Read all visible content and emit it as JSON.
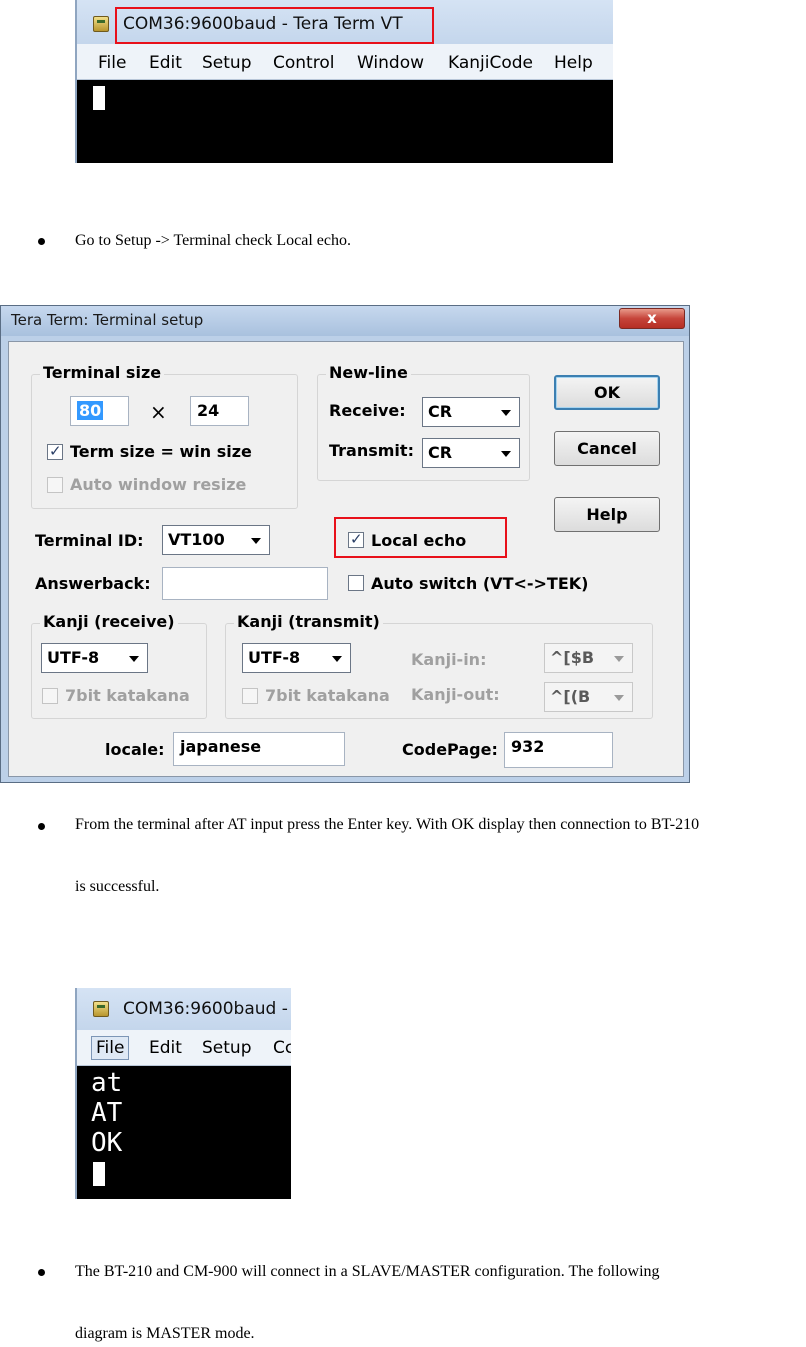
{
  "screenshot1": {
    "title": "COM36:9600baud - Tera Term VT",
    "menu": [
      "File",
      "Edit",
      "Setup",
      "Control",
      "Window",
      "KanjiCode",
      "Help"
    ]
  },
  "bullets": [
    "Go to Setup -> Terminal check Local echo.",
    "From the terminal after AT input press the Enter key. With OK display then connection to BT-210",
    "is successful.",
    "The BT-210 and CM-900 will connect in a SLAVE/MASTER configuration. The following",
    "diagram is MASTER mode."
  ],
  "dialog": {
    "title": "Tera Term: Terminal setup",
    "close": "x",
    "terminal_size": {
      "label": "Terminal size",
      "cols": "80",
      "times": "×",
      "rows": "24",
      "term_eq_win": "Term size = win size",
      "auto_resize": "Auto window resize"
    },
    "newline": {
      "label": "New-line",
      "receive_label": "Receive:",
      "receive_value": "CR",
      "transmit_label": "Transmit:",
      "transmit_value": "CR"
    },
    "buttons": {
      "ok": "OK",
      "cancel": "Cancel",
      "help": "Help"
    },
    "terminal_id_label": "Terminal ID:",
    "terminal_id_value": "VT100",
    "local_echo": "Local echo",
    "answerback_label": "Answerback:",
    "answerback_value": "",
    "auto_switch": "Auto switch (VT<->TEK)",
    "kanji_receive": {
      "label": "Kanji (receive)",
      "value": "UTF-8",
      "katakana": "7bit katakana"
    },
    "kanji_transmit": {
      "label": "Kanji (transmit)",
      "value": "UTF-8",
      "katakana": "7bit katakana",
      "kanji_in_label": "Kanji-in:",
      "kanji_in_value": "^[$B",
      "kanji_out_label": "Kanji-out:",
      "kanji_out_value": "^[(B"
    },
    "locale_label": "locale:",
    "locale_value": "japanese",
    "codepage_label": "CodePage:",
    "codepage_value": "932"
  },
  "screenshot2": {
    "title": "COM36:9600baud -",
    "menu": [
      "File",
      "Edit",
      "Setup",
      "Cc"
    ],
    "lines": [
      "at",
      "AT",
      "OK"
    ]
  },
  "colors": {
    "highlight_red": "#e8101a",
    "terminal_bg": "#000000"
  }
}
